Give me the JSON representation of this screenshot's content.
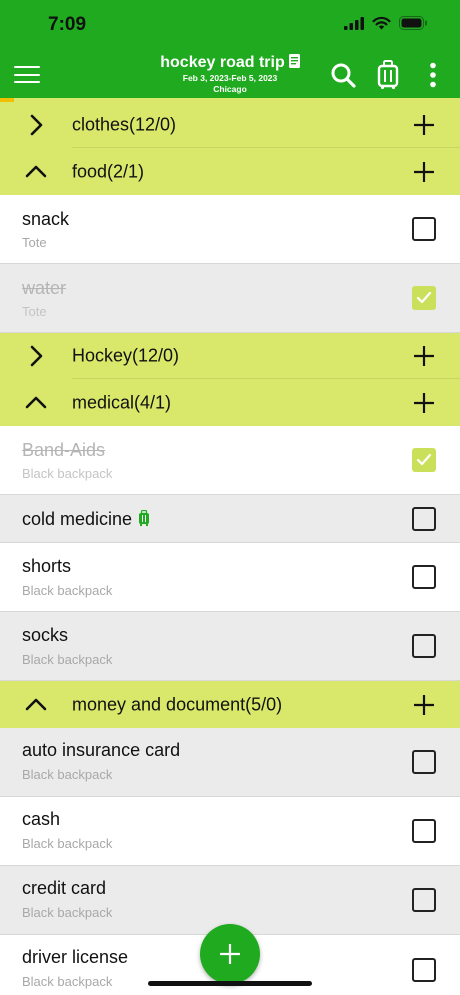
{
  "status_bar": {
    "time": "7:09"
  },
  "header": {
    "title": "hockey road trip",
    "dates": "Feb 3, 2023-Feb 5, 2023",
    "location": "Chicago",
    "icons": [
      "menu-icon",
      "note-icon",
      "search-icon",
      "luggage-icon",
      "more-vertical-icon"
    ]
  },
  "categories": {
    "clothes": {
      "label": "clothes(12/0)",
      "expanded": false
    },
    "food": {
      "label": "food(2/1)",
      "expanded": true
    },
    "hockey": {
      "label": "Hockey(12/0)",
      "expanded": false
    },
    "medical": {
      "label": "medical(4/1)",
      "expanded": true
    },
    "money": {
      "label": "money and document(5/0)",
      "expanded": true
    }
  },
  "items": {
    "snack": {
      "name": "snack",
      "bag": "Tote",
      "checked": false
    },
    "water": {
      "name": "water",
      "bag": "Tote",
      "checked": true
    },
    "band_aids": {
      "name": "Band-Aids",
      "bag": "Black backpack",
      "checked": true
    },
    "cold_medicine": {
      "name": "cold medicine",
      "bag": "",
      "checked": false
    },
    "shorts": {
      "name": "shorts",
      "bag": "Black backpack",
      "checked": false
    },
    "socks": {
      "name": "socks",
      "bag": "Black backpack",
      "checked": false
    },
    "auto_insurance": {
      "name": "auto insurance card",
      "bag": "Black backpack",
      "checked": false
    },
    "cash": {
      "name": "cash",
      "bag": "Black backpack",
      "checked": false
    },
    "credit_card": {
      "name": "credit card",
      "bag": "Black backpack",
      "checked": false
    },
    "driver_license": {
      "name": "driver license",
      "bag": "Black backpack",
      "checked": false
    }
  },
  "colors": {
    "primary_green": "#1faa1f",
    "category_bar": "#d9e86a",
    "checked_box": "#cbe05a"
  }
}
